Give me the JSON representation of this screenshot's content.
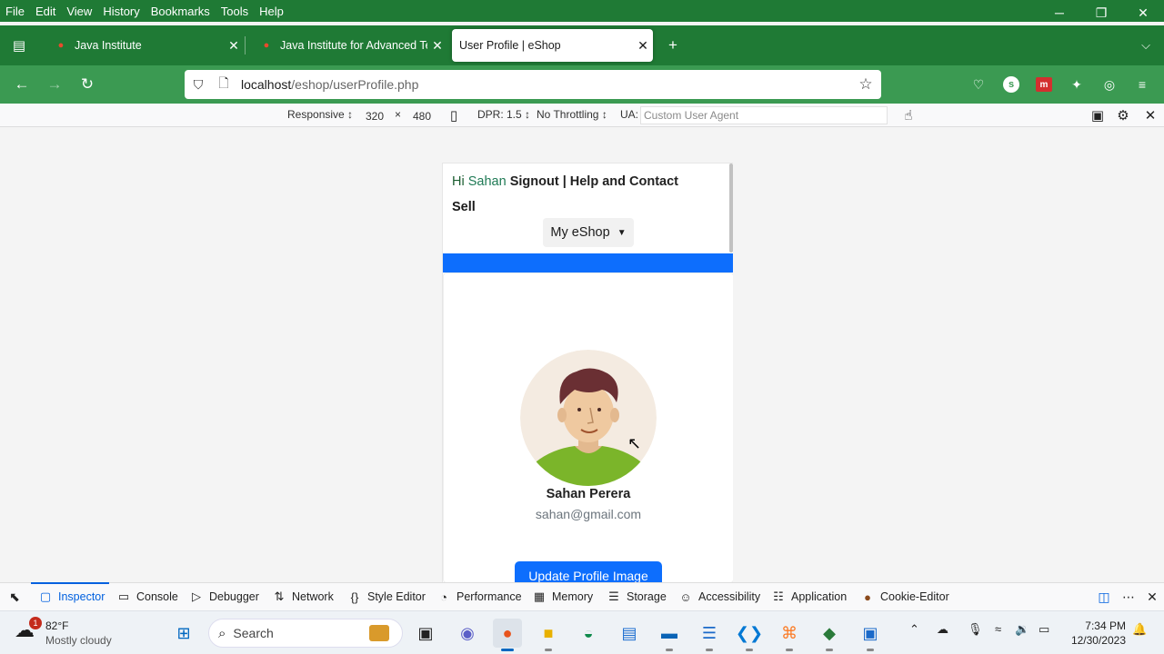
{
  "browser": {
    "menu": [
      "File",
      "Edit",
      "View",
      "History",
      "Bookmarks",
      "Tools",
      "Help"
    ],
    "window_controls": [
      "minimize-icon",
      "restore-icon",
      "close-icon"
    ],
    "tabs": [
      {
        "title": "Java Institute",
        "active": false
      },
      {
        "title": "Java Institute for Advanced Tec",
        "active": false
      },
      {
        "title": "User Profile | eShop",
        "active": true
      }
    ],
    "url_host": "localhost",
    "url_path": "/eshop/userProfile.php",
    "colors": {
      "chrome_dark": "#1f7a35",
      "chrome_light": "#3b9a52"
    }
  },
  "rdm": {
    "device": "Responsive ↕",
    "width": "320",
    "times": "×",
    "height": "480",
    "dpr": "DPR: 1.5 ↕",
    "throttling": "No Throttling ↕",
    "ua_label": "UA:",
    "ua_placeholder": "Custom User Agent"
  },
  "page": {
    "greeting_hi": "Hi",
    "greeting_name": "Sahan",
    "header_links": "Signout | Help and Contact",
    "sell": "Sell",
    "dropdown": "My eShop",
    "user_name": "Sahan Perera",
    "user_email": "sahan@gmail.com",
    "update_button": "Update Profile Image",
    "accent_color": "#0d6efd"
  },
  "devtools": {
    "tabs": [
      {
        "label": "Inspector",
        "icon": "inspector-icon",
        "active": true
      },
      {
        "label": "Console",
        "icon": "console-icon"
      },
      {
        "label": "Debugger",
        "icon": "debugger-icon"
      },
      {
        "label": "Network",
        "icon": "network-icon"
      },
      {
        "label": "Style Editor",
        "icon": "style-editor-icon"
      },
      {
        "label": "Performance",
        "icon": "performance-icon"
      },
      {
        "label": "Memory",
        "icon": "memory-icon"
      },
      {
        "label": "Storage",
        "icon": "storage-icon"
      },
      {
        "label": "Accessibility",
        "icon": "accessibility-icon"
      },
      {
        "label": "Application",
        "icon": "application-icon"
      },
      {
        "label": "Cookie-Editor",
        "icon": "cookie-icon"
      }
    ]
  },
  "taskbar": {
    "weather_badge": "1",
    "temperature": "82°F",
    "weather_desc": "Mostly cloudy",
    "search_placeholder": "Search",
    "time": "7:34 PM",
    "date": "12/30/2023"
  }
}
